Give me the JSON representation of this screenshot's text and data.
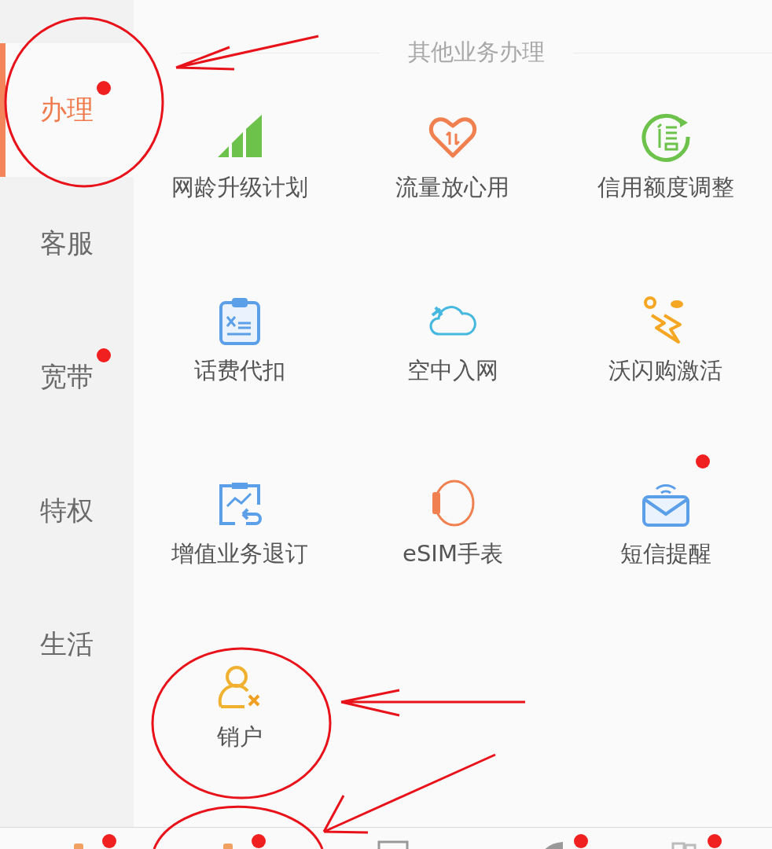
{
  "sidebar": {
    "items": [
      {
        "label": "办理",
        "selected": true,
        "badge": true
      },
      {
        "label": "客服",
        "selected": false,
        "badge": false
      },
      {
        "label": "宽带",
        "selected": false,
        "badge": true
      },
      {
        "label": "特权",
        "selected": false,
        "badge": false
      },
      {
        "label": "生活",
        "selected": false,
        "badge": false
      }
    ]
  },
  "section": {
    "title": "其他业务办理",
    "items": [
      {
        "label": "网龄升级计划",
        "badge": false
      },
      {
        "label": "流量放心用",
        "badge": false
      },
      {
        "label": "信用额度调整",
        "badge": false
      },
      {
        "label": "话费代扣",
        "badge": false
      },
      {
        "label": "空中入网",
        "badge": false
      },
      {
        "label": "沃闪购激活",
        "badge": false
      },
      {
        "label": "增值业务退订",
        "badge": false
      },
      {
        "label": "eSIM手表",
        "badge": false
      },
      {
        "label": "短信提醒",
        "badge": true
      },
      {
        "label": "销户",
        "badge": false
      }
    ]
  },
  "tab_bar": [
    {
      "badge": true
    },
    {
      "badge": true
    },
    {
      "badge": false
    },
    {
      "badge": true
    },
    {
      "badge": true
    }
  ]
}
